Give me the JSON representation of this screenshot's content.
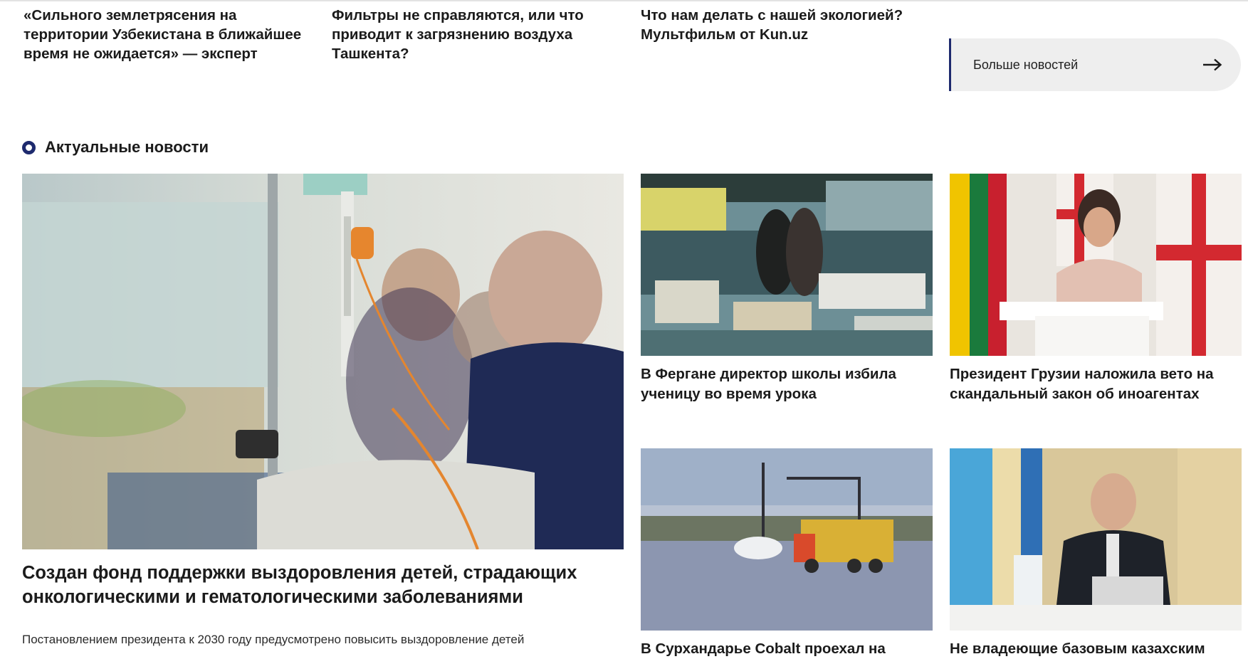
{
  "top_news": [
    "«Сильного землетрясения на территории Узбекистана в ближайшее время не ожидается» — эксперт",
    "Фильтры не справляются, или что приводит к загрязнению воздуха Ташкента?",
    "Что нам делать с нашей экологией? Мультфильм от Kun.uz"
  ],
  "more_button": {
    "label": "Больше новостей",
    "icon": "arrow-right-icon"
  },
  "section": {
    "title": "Актуальные новости",
    "icon": "ring-bullet-icon",
    "accent": "#1e2a6e"
  },
  "featured": {
    "title": "Создан фонд поддержки выздоровления детей, страдающих онкологическими и гематологическими заболеваниями",
    "lead": "Постановлением президента к 2030 году предусмотрено повысить выздоровление детей"
  },
  "cards": [
    {
      "title": "В Фергане директор школы избила ученицу во время урока"
    },
    {
      "title": "Президент Грузии наложила вето на скандальный закон об иноагентах"
    },
    {
      "title": "В Сурхандарье Cobalt проехал на"
    },
    {
      "title": "Не владеющие базовым казахским"
    }
  ]
}
